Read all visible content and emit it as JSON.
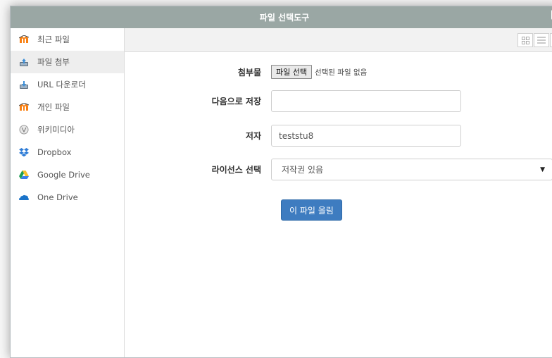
{
  "dialog": {
    "title": "파일 선택도구",
    "close_label": "×"
  },
  "sidebar": {
    "items": [
      {
        "label": "최근 파일",
        "icon": "moodle-icon"
      },
      {
        "label": "파일 첨부",
        "icon": "upload-icon"
      },
      {
        "label": "URL 다운로더",
        "icon": "download-icon"
      },
      {
        "label": "개인 파일",
        "icon": "moodle-icon"
      },
      {
        "label": "위키미디아",
        "icon": "wikimedia-icon"
      },
      {
        "label": "Dropbox",
        "icon": "dropbox-icon"
      },
      {
        "label": "Google Drive",
        "icon": "google-drive-icon"
      },
      {
        "label": "One Drive",
        "icon": "onedrive-icon"
      }
    ],
    "active_index": 1
  },
  "toolbar": {
    "view_icons": [
      "grid-view-icon",
      "list-view-icon",
      "tree-view-icon"
    ]
  },
  "form": {
    "attachment": {
      "label": "첨부물",
      "button": "파일 선택",
      "status": "선택된 파일 없음"
    },
    "save_as": {
      "label": "다음으로 저장",
      "value": ""
    },
    "author": {
      "label": "저자",
      "value": "teststu8"
    },
    "license": {
      "label": "라이선스 선택",
      "value": "저작권 있음"
    },
    "upload_button": "이 파일 올림"
  },
  "colors": {
    "titlebar": "#9aa7a4",
    "primary_button": "#3e7cc0",
    "moodle_orange": "#f98012",
    "sidebar_active": "#eeeeee"
  }
}
